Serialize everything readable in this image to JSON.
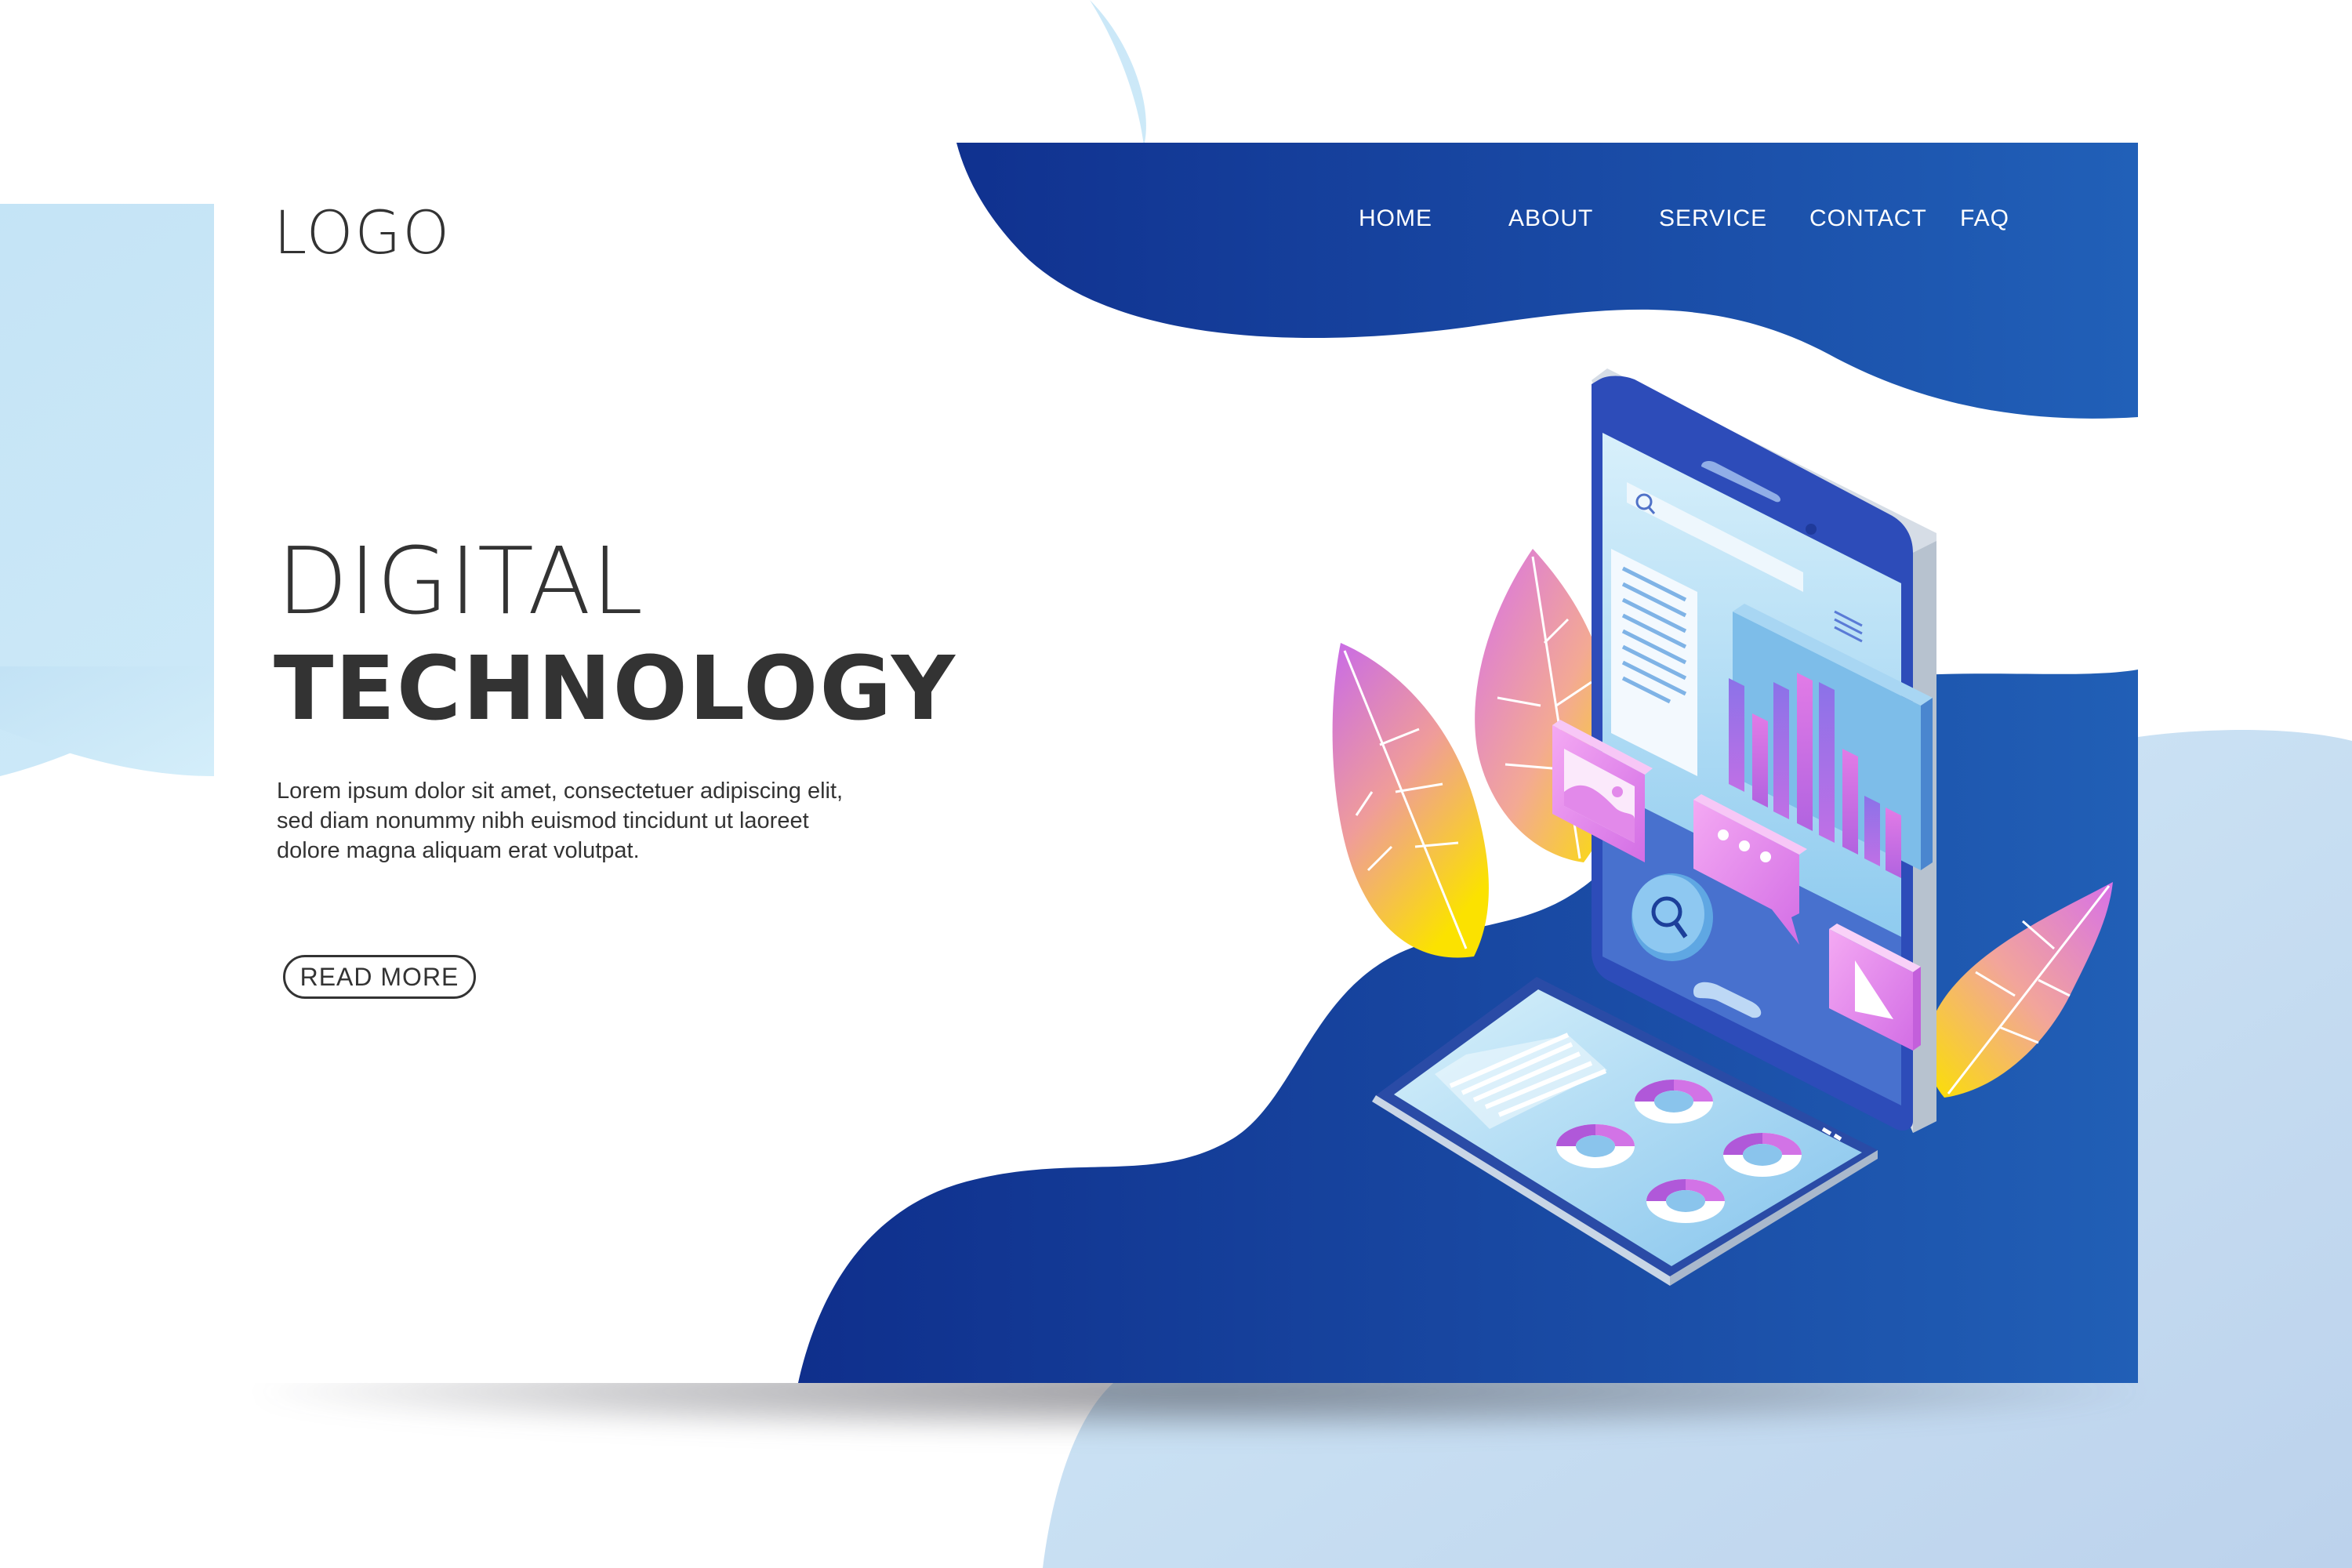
{
  "header": {
    "logo": "LOGO",
    "nav": [
      {
        "label": "HOME"
      },
      {
        "label": "ABOUT"
      },
      {
        "label": "SERVICE"
      },
      {
        "label": "CONTACT"
      },
      {
        "label": "FAQ"
      }
    ]
  },
  "hero": {
    "title_light": "DIGITAL",
    "title_bold": "TECHNOLOGY",
    "body_lines": [
      "Lorem ipsum dolor sit amet, consectetuer adipiscing elit,",
      "sed diam nonummy nibh euismod tincidunt ut laoreet",
      "dolore magna aliquam erat volutpat."
    ],
    "cta_label": "READ MORE"
  },
  "colors": {
    "primary_blue": "#16379a",
    "light_blue_background": "#cdeaf7",
    "text_dark": "#333333",
    "accent_pink": "#d96be6",
    "accent_yellow": "#fbe300"
  },
  "icons": [
    "search-icon",
    "image-icon",
    "chat-bubble-icon",
    "play-icon",
    "bar-chart-icon",
    "donut-chart-icon",
    "leaf-icon"
  ]
}
